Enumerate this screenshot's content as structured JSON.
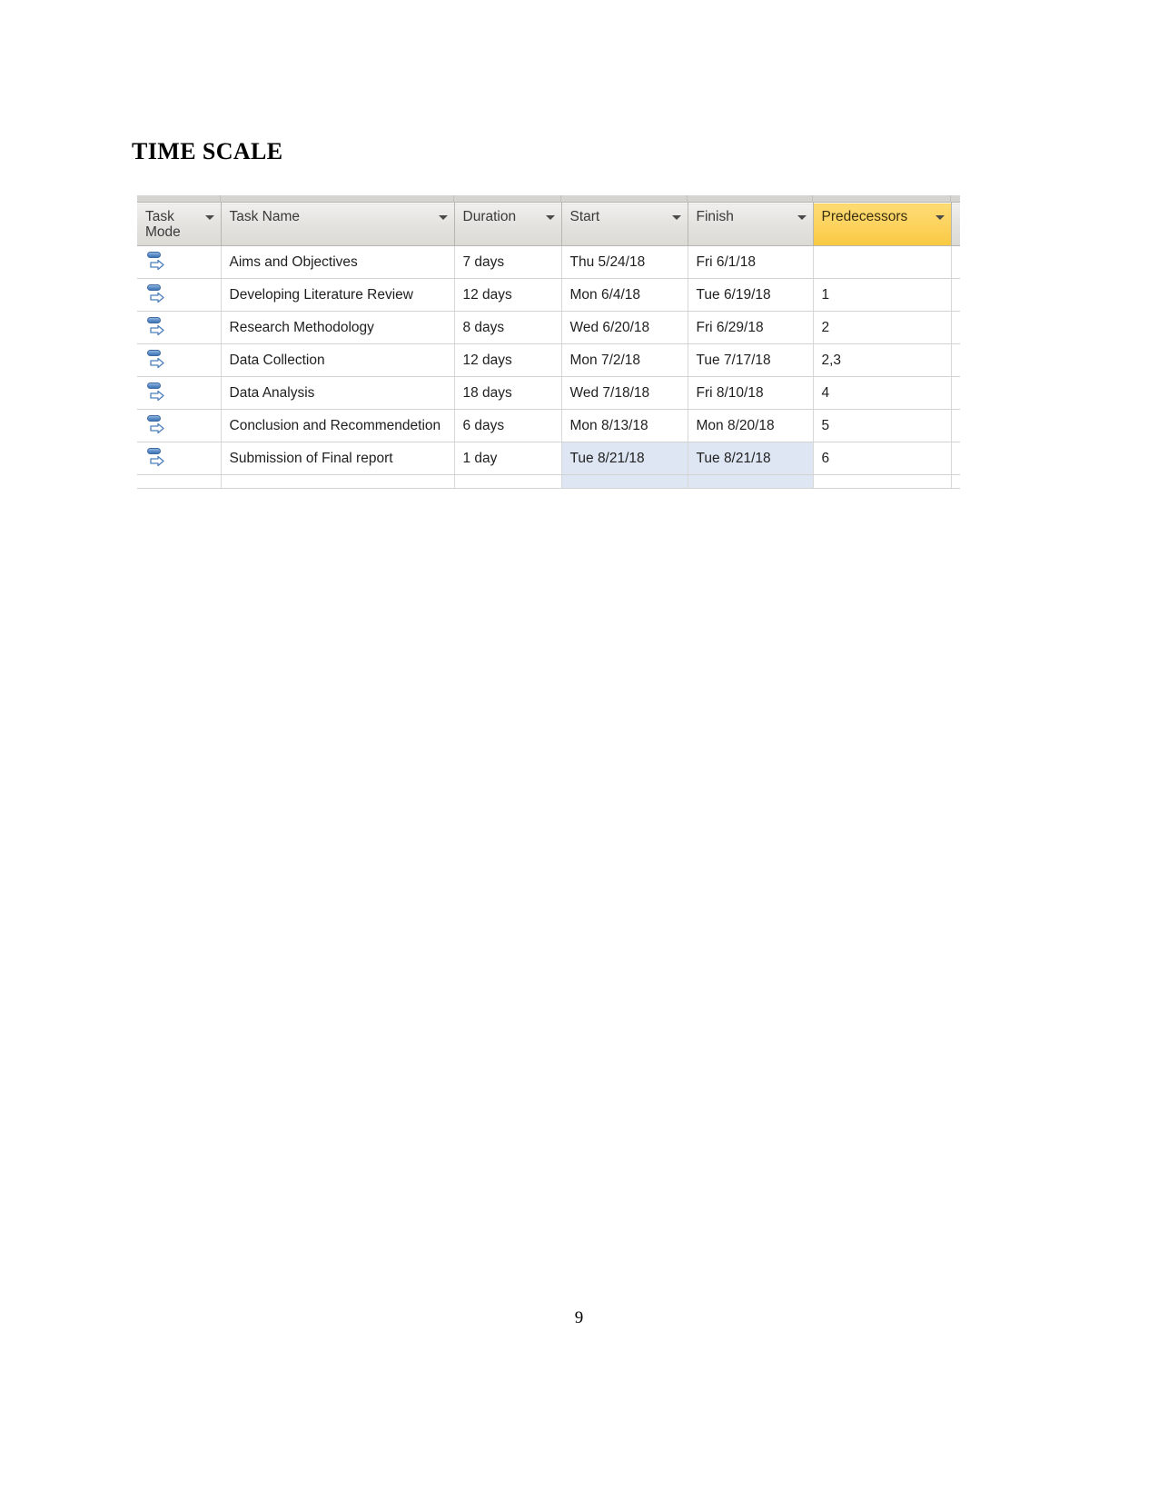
{
  "document": {
    "heading": "TIME SCALE",
    "page_number": "9"
  },
  "grid": {
    "columns": [
      {
        "key": "mode",
        "label": "Task Mode",
        "has_filter": true,
        "highlighted": false
      },
      {
        "key": "name",
        "label": "Task Name",
        "has_filter": true,
        "highlighted": false
      },
      {
        "key": "duration",
        "label": "Duration",
        "has_filter": true,
        "highlighted": false
      },
      {
        "key": "start",
        "label": "Start",
        "has_filter": true,
        "highlighted": false
      },
      {
        "key": "finish",
        "label": "Finish",
        "has_filter": true,
        "highlighted": false
      },
      {
        "key": "predecessors",
        "label": "Predecessors",
        "has_filter": true,
        "highlighted": true
      }
    ],
    "highlight_color": "#fcd25c",
    "selection_color": "#dde6f2",
    "rows": [
      {
        "mode_icon": "auto-scheduled-icon",
        "name": "Aims and Objectives",
        "duration": "7 days",
        "start": "Thu 5/24/18",
        "finish": "Fri 6/1/18",
        "predecessors": "",
        "selected": false
      },
      {
        "mode_icon": "auto-scheduled-icon",
        "name": "Developing Literature Review",
        "duration": "12 days",
        "start": "Mon 6/4/18",
        "finish": "Tue 6/19/18",
        "predecessors": "1",
        "selected": false
      },
      {
        "mode_icon": "auto-scheduled-icon",
        "name": "Research Methodology",
        "duration": "8 days",
        "start": "Wed 6/20/18",
        "finish": "Fri 6/29/18",
        "predecessors": "2",
        "selected": false
      },
      {
        "mode_icon": "auto-scheduled-icon",
        "name": "Data Collection",
        "duration": "12 days",
        "start": "Mon 7/2/18",
        "finish": "Tue 7/17/18",
        "predecessors": "2,3",
        "selected": false
      },
      {
        "mode_icon": "auto-scheduled-icon",
        "name": "Data Analysis",
        "duration": "18 days",
        "start": "Wed 7/18/18",
        "finish": "Fri 8/10/18",
        "predecessors": "4",
        "selected": false
      },
      {
        "mode_icon": "auto-scheduled-icon",
        "name": "Conclusion and Recommendetion",
        "duration": "6 days",
        "start": "Mon 8/13/18",
        "finish": "Mon 8/20/18",
        "predecessors": "5",
        "selected": false
      },
      {
        "mode_icon": "auto-scheduled-icon",
        "name": "Submission of Final report",
        "duration": "1 day",
        "start": "Tue 8/21/18",
        "finish": "Tue 8/21/18",
        "predecessors": "6",
        "selected": true
      }
    ]
  }
}
